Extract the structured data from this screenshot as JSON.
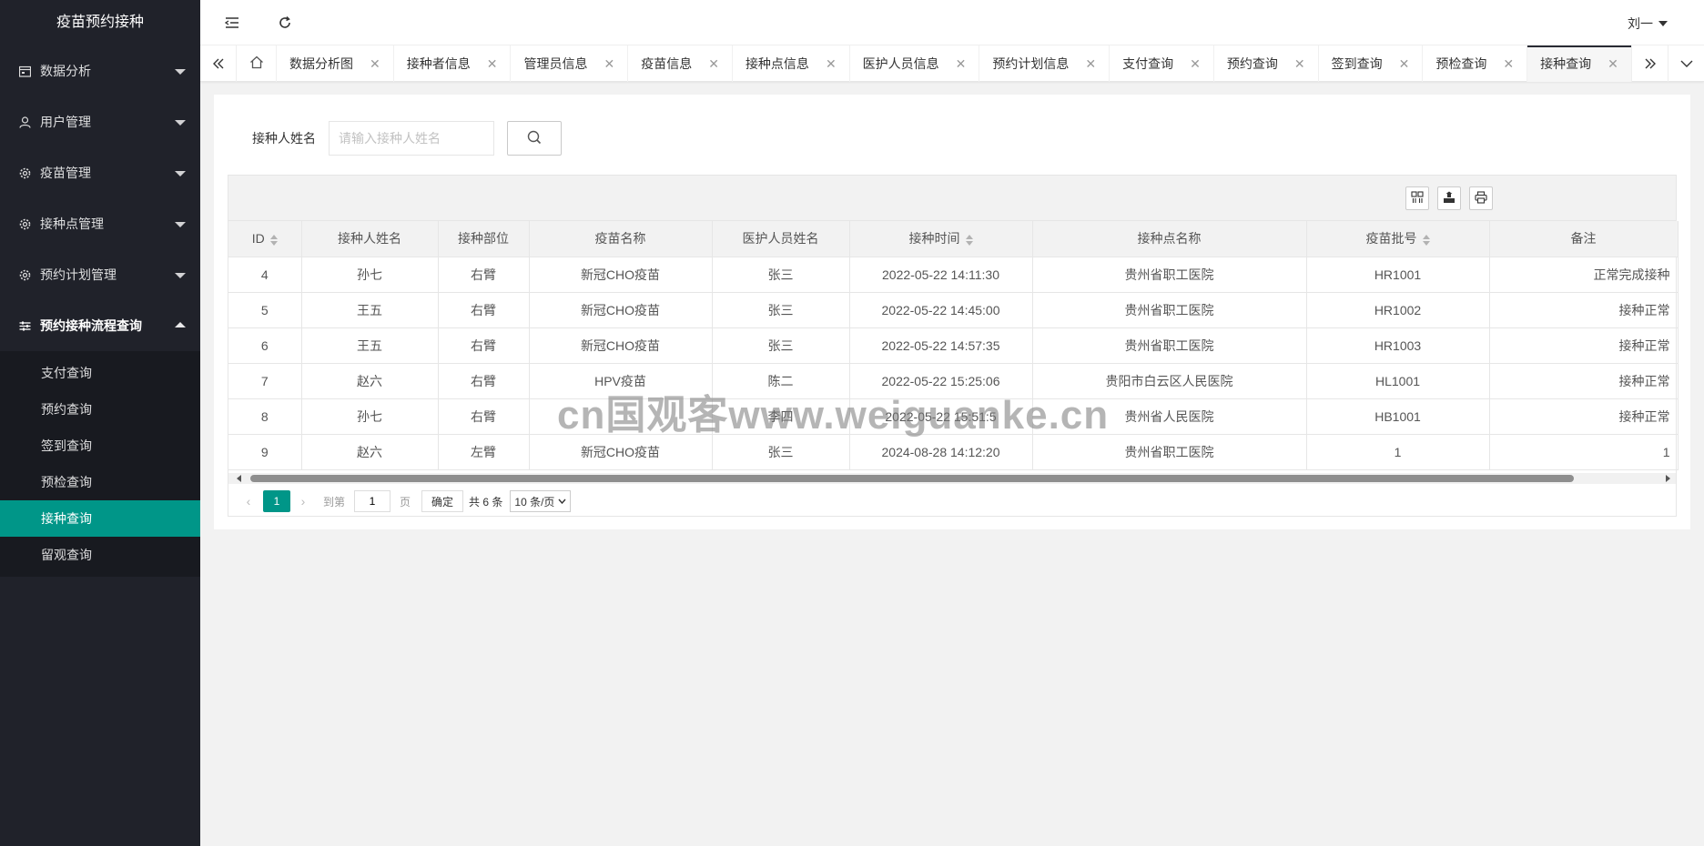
{
  "app": {
    "title": "疫苗预约接种"
  },
  "sidebar": {
    "menus": [
      {
        "label": "数据分析",
        "icon": "calendar-icon"
      },
      {
        "label": "用户管理",
        "icon": "user-icon"
      },
      {
        "label": "疫苗管理",
        "icon": "gear-icon"
      },
      {
        "label": "接种点管理",
        "icon": "gear-icon"
      },
      {
        "label": "预约计划管理",
        "icon": "gear-icon"
      },
      {
        "label": "预约接种流程查询",
        "icon": "sliders-icon"
      }
    ],
    "submenu": [
      "支付查询",
      "预约查询",
      "签到查询",
      "预检查询",
      "接种查询",
      "留观查询"
    ],
    "active_sub": "接种查询"
  },
  "header": {
    "user": "刘一"
  },
  "tabs": [
    "数据分析图",
    "接种者信息",
    "管理员信息",
    "疫苗信息",
    "接种点信息",
    "医护人员信息",
    "预约计划信息",
    "支付查询",
    "预约查询",
    "签到查询",
    "预检查询",
    "接种查询"
  ],
  "search": {
    "label": "接种人姓名",
    "placeholder": "请输入接种人姓名"
  },
  "table": {
    "columns": [
      "ID",
      "接种人姓名",
      "接种部位",
      "疫苗名称",
      "医护人员姓名",
      "接种时间",
      "接种点名称",
      "疫苗批号",
      "备注"
    ],
    "rows": [
      [
        "4",
        "孙七",
        "右臂",
        "新冠CHO疫苗",
        "张三",
        "2022-05-22 14:11:30",
        "贵州省职工医院",
        "HR1001",
        "正常完成接种"
      ],
      [
        "5",
        "王五",
        "右臂",
        "新冠CHO疫苗",
        "张三",
        "2022-05-22 14:45:00",
        "贵州省职工医院",
        "HR1002",
        "接种正常"
      ],
      [
        "6",
        "王五",
        "右臂",
        "新冠CHO疫苗",
        "张三",
        "2022-05-22 14:57:35",
        "贵州省职工医院",
        "HR1003",
        "接种正常"
      ],
      [
        "7",
        "赵六",
        "右臂",
        "HPV疫苗",
        "陈二",
        "2022-05-22 15:25:06",
        "贵阳市白云区人民医院",
        "HL1001",
        "接种正常"
      ],
      [
        "8",
        "孙七",
        "右臂",
        "",
        "李四",
        "2022-05-22 15:51:5",
        "贵州省人民医院",
        "HB1001",
        "接种正常"
      ],
      [
        "9",
        "赵六",
        "左臂",
        "新冠CHO疫苗",
        "张三",
        "2024-08-28 14:12:20",
        "贵州省职工医院",
        "1",
        "1"
      ]
    ]
  },
  "pager": {
    "current": "1",
    "goto_label": "到第",
    "goto_value": "1",
    "page_unit": "页",
    "confirm": "确定",
    "total": "共 6 条",
    "page_size": "10 条/页"
  },
  "watermark": "cn国观客www.weiguanke.cn"
}
